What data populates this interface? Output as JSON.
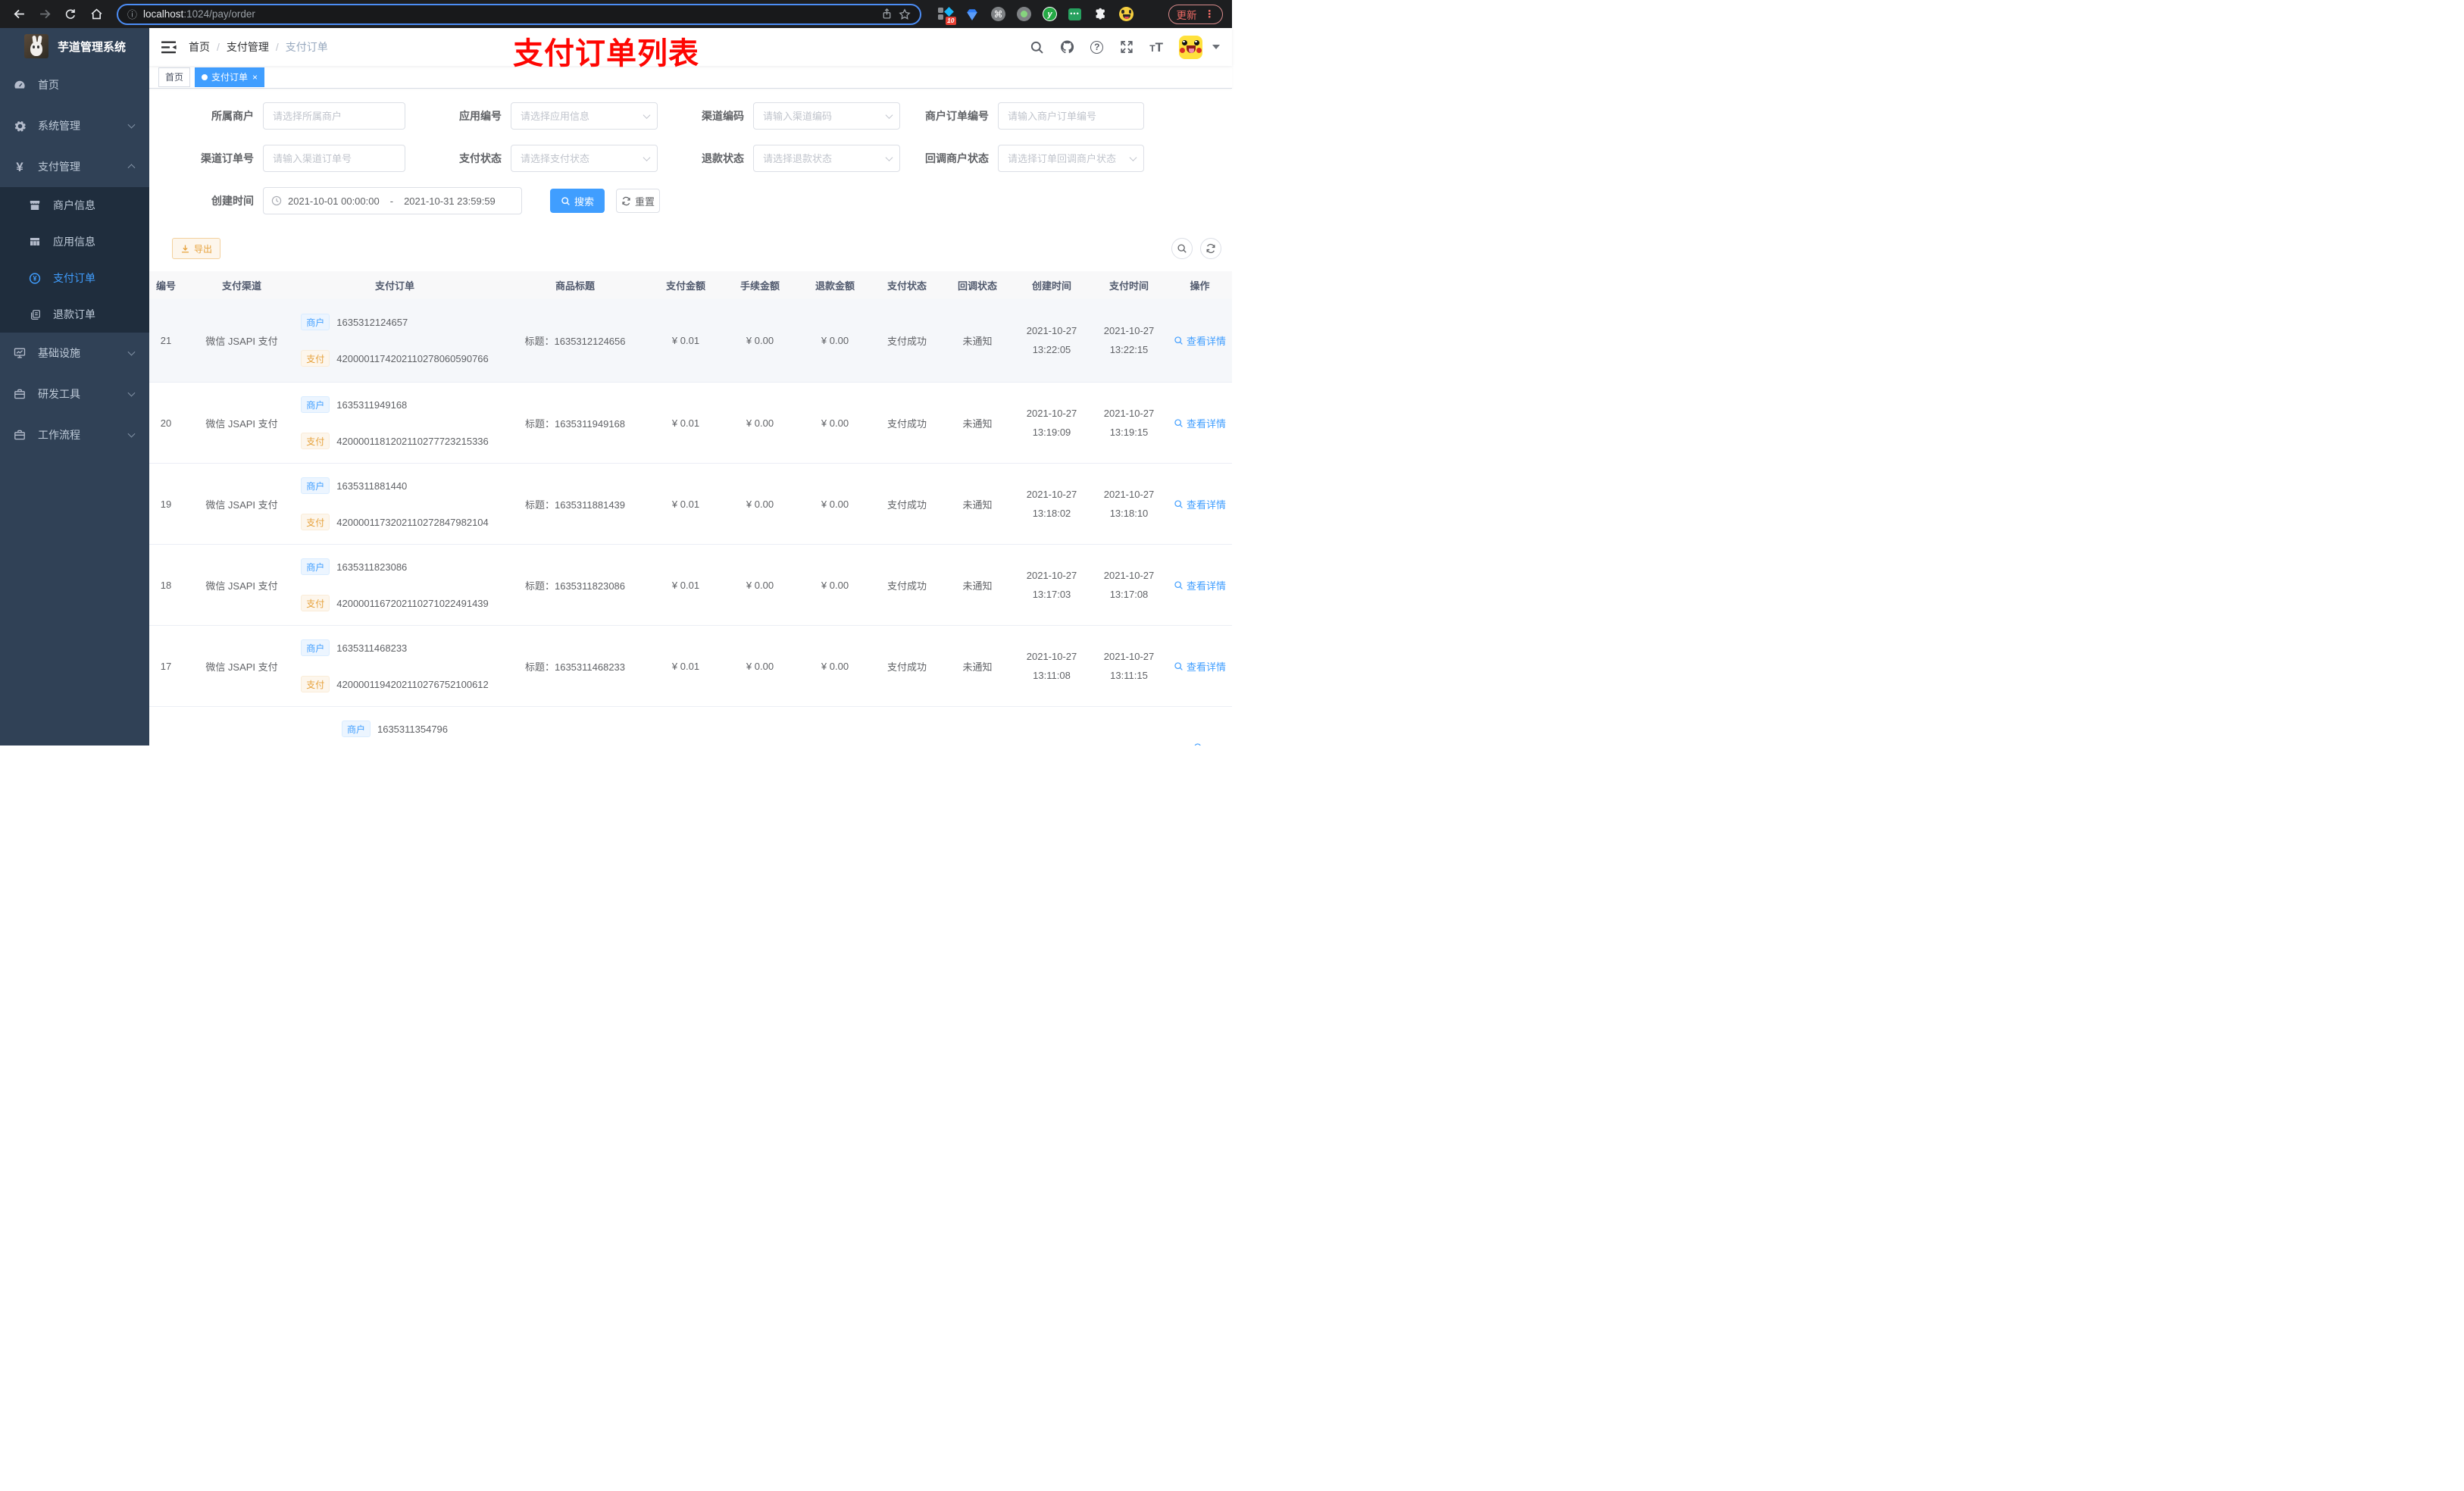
{
  "browser": {
    "url_host": "localhost",
    "url_path": ":1024/pay/order",
    "extension_badge": "10",
    "extension_chat_dots": "•••",
    "extension_y_label": "y",
    "command_glyph": "⌘",
    "update_label": "更新"
  },
  "sidebar": {
    "app_title": "芋道管理系统",
    "items": [
      {
        "label": "首页"
      },
      {
        "label": "系统管理"
      },
      {
        "label": "支付管理",
        "children": [
          {
            "label": "商户信息"
          },
          {
            "label": "应用信息"
          },
          {
            "label": "支付订单"
          },
          {
            "label": "退款订单"
          }
        ]
      },
      {
        "label": "基础设施"
      },
      {
        "label": "研发工具"
      },
      {
        "label": "工作流程"
      }
    ]
  },
  "navbar": {
    "breadcrumb": [
      "首页",
      "支付管理",
      "支付订单"
    ],
    "annotation": "支付订单列表"
  },
  "tabs": [
    {
      "label": "首页"
    },
    {
      "label": "支付订单"
    }
  ],
  "filters": {
    "fields": [
      {
        "label": "所属商户",
        "placeholder": "请选择所属商户",
        "type": "input"
      },
      {
        "label": "应用编号",
        "placeholder": "请选择应用信息",
        "type": "select"
      },
      {
        "label": "渠道编码",
        "placeholder": "请输入渠道编码",
        "type": "select"
      },
      {
        "label": "商户订单编号",
        "placeholder": "请输入商户订单编号",
        "type": "input"
      },
      {
        "label": "渠道订单号",
        "placeholder": "请输入渠道订单号",
        "type": "input"
      },
      {
        "label": "支付状态",
        "placeholder": "请选择支付状态",
        "type": "select"
      },
      {
        "label": "退款状态",
        "placeholder": "请选择退款状态",
        "type": "select"
      },
      {
        "label": "回调商户状态",
        "placeholder": "请选择订单回调商户状态",
        "type": "select"
      }
    ],
    "date_label": "创建时间",
    "date_start": "2021-10-01 00:00:00",
    "date_end": "2021-10-31 23:59:59",
    "search_label": "搜索",
    "reset_label": "重置"
  },
  "toolbar": {
    "export_label": "导出"
  },
  "table": {
    "columns": [
      "编号",
      "支付渠道",
      "支付订单",
      "商品标题",
      "支付金额",
      "手续金额",
      "退款金额",
      "支付状态",
      "回调状态",
      "创建时间",
      "支付时间",
      "操作"
    ],
    "tag_merchant": "商户",
    "tag_pay": "支付",
    "rows": [
      {
        "id": "21",
        "channel": "微信 JSAPI 支付",
        "merchant_no": "1635312124657",
        "pay_no": "4200001174202110278060590766",
        "title": "标题：1635312124656",
        "amount": "¥ 0.01",
        "fee": "¥ 0.00",
        "refund": "¥ 0.00",
        "status": "支付成功",
        "notify": "未通知",
        "create_date": "2021-10-27",
        "create_time": "13:22:05",
        "pay_date": "2021-10-27",
        "pay_time": "13:22:15",
        "action": "查看详情"
      },
      {
        "id": "20",
        "channel": "微信 JSAPI 支付",
        "merchant_no": "1635311949168",
        "pay_no": "4200001181202110277723215336",
        "title": "标题：1635311949168",
        "amount": "¥ 0.01",
        "fee": "¥ 0.00",
        "refund": "¥ 0.00",
        "status": "支付成功",
        "notify": "未通知",
        "create_date": "2021-10-27",
        "create_time": "13:19:09",
        "pay_date": "2021-10-27",
        "pay_time": "13:19:15",
        "action": "查看详情"
      },
      {
        "id": "19",
        "channel": "微信 JSAPI 支付",
        "merchant_no": "1635311881440",
        "pay_no": "4200001173202110272847982104",
        "title": "标题：1635311881439",
        "amount": "¥ 0.01",
        "fee": "¥ 0.00",
        "refund": "¥ 0.00",
        "status": "支付成功",
        "notify": "未通知",
        "create_date": "2021-10-27",
        "create_time": "13:18:02",
        "pay_date": "2021-10-27",
        "pay_time": "13:18:10",
        "action": "查看详情"
      },
      {
        "id": "18",
        "channel": "微信 JSAPI 支付",
        "merchant_no": "1635311823086",
        "pay_no": "4200001167202110271022491439",
        "title": "标题：1635311823086",
        "amount": "¥ 0.01",
        "fee": "¥ 0.00",
        "refund": "¥ 0.00",
        "status": "支付成功",
        "notify": "未通知",
        "create_date": "2021-10-27",
        "create_time": "13:17:03",
        "pay_date": "2021-10-27",
        "pay_time": "13:17:08",
        "action": "查看详情"
      },
      {
        "id": "17",
        "channel": "微信 JSAPI 支付",
        "merchant_no": "1635311468233",
        "pay_no": "4200001194202110276752100612",
        "title": "标题：1635311468233",
        "amount": "¥ 0.01",
        "fee": "¥ 0.00",
        "refund": "¥ 0.00",
        "status": "支付成功",
        "notify": "未通知",
        "create_date": "2021-10-27",
        "create_time": "13:11:08",
        "pay_date": "2021-10-27",
        "pay_time": "13:11:15",
        "action": "查看详情"
      },
      {
        "id": "",
        "channel": "",
        "merchant_no": "1635311354796",
        "pay_no": "",
        "title": "",
        "amount": "",
        "fee": "",
        "refund": "",
        "status": "",
        "notify": "",
        "create_date": "",
        "create_time": "",
        "pay_date": "",
        "pay_time": "",
        "action": ""
      }
    ]
  },
  "colors": {
    "accent": "#409eff",
    "warning": "#e6a23c",
    "annotation": "#ff0000",
    "sidebar_bg": "#304156"
  }
}
